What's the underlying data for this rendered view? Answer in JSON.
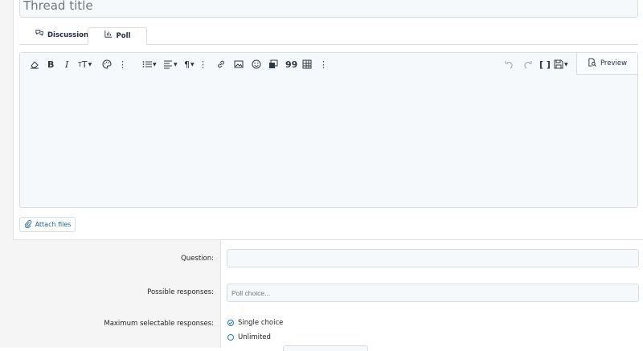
{
  "thread_title": {
    "placeholder": "Thread title"
  },
  "tabs": [
    {
      "label": "Discussion",
      "icon": "chat-bubbles-icon"
    },
    {
      "label": "Poll",
      "icon": "bar-chart-icon",
      "active": true
    }
  ],
  "editor": {
    "preview_label": "Preview"
  },
  "attach": {
    "label": "Attach files"
  },
  "poll_form": {
    "question_label": "Question:",
    "question_value": "",
    "responses_label": "Possible responses:",
    "responses_placeholder": "Poll choice...",
    "max_label": "Maximum selectable responses:",
    "options": [
      {
        "label": "Single choice",
        "selected": true
      },
      {
        "label": "Unlimited",
        "selected": false
      }
    ]
  },
  "colors": {
    "accent": "#2577b1",
    "link": "#1d5a86",
    "field_bg": "#f6f9fb"
  }
}
